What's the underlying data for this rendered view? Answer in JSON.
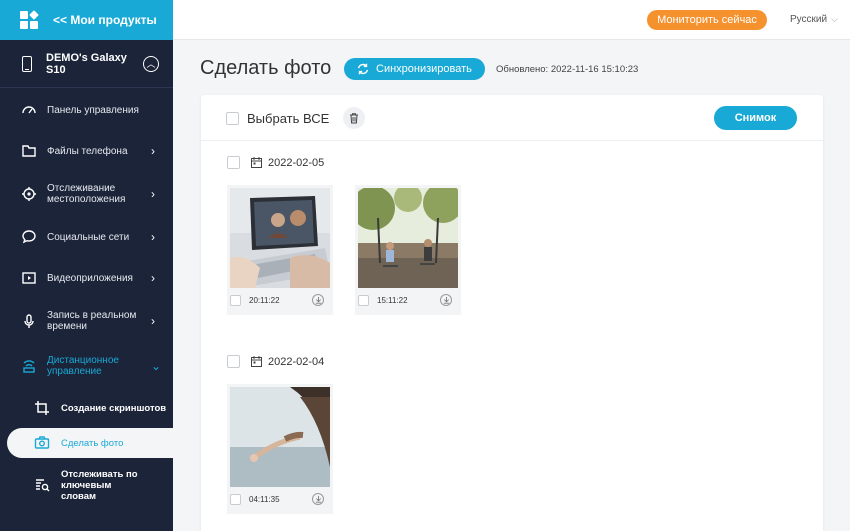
{
  "sidebar": {
    "top_title": "<< Мои продукты",
    "device_name": "DEMO's Galaxy S10",
    "items": [
      {
        "label": "Панель управления",
        "icon": "dashboard-icon"
      },
      {
        "label": "Файлы телефона",
        "icon": "files-icon"
      },
      {
        "label": "Отслеживание местоположения",
        "icon": "location-icon"
      },
      {
        "label": "Социальные сети",
        "icon": "chat-icon"
      },
      {
        "label": "Видеоприложения",
        "icon": "video-icon"
      },
      {
        "label": "Запись в реальном времени",
        "icon": "microphone-icon"
      },
      {
        "label": "Дистанционное управление",
        "icon": "remote-icon"
      }
    ],
    "sub_items": [
      {
        "label": "Создание скриншотов",
        "icon": "crop-icon"
      },
      {
        "label": "Сделать фото",
        "icon": "camera-icon"
      },
      {
        "label": "Отслеживать по ключевым словам",
        "icon": "keyword-search-icon"
      }
    ]
  },
  "topbar": {
    "monitor_label": "Мониторить сейчас",
    "language": "Русский"
  },
  "header": {
    "title": "Сделать фото",
    "sync_label": "Синхронизировать",
    "updated": "Обновлено: 2022-11-16 15:10:23"
  },
  "card": {
    "select_all_label": "Выбрать ВСЕ",
    "snapshot_label": "Снимок",
    "groups": [
      {
        "date": "2022-02-05",
        "photos": [
          {
            "time": "20:11:22"
          },
          {
            "time": "15:11:22"
          }
        ]
      },
      {
        "date": "2022-02-04",
        "photos": [
          {
            "time": "04:11:35"
          }
        ]
      }
    ]
  },
  "colors": {
    "accent": "#19a9d6",
    "sidebar": "#1b2438",
    "monitor": "#f5922e"
  }
}
